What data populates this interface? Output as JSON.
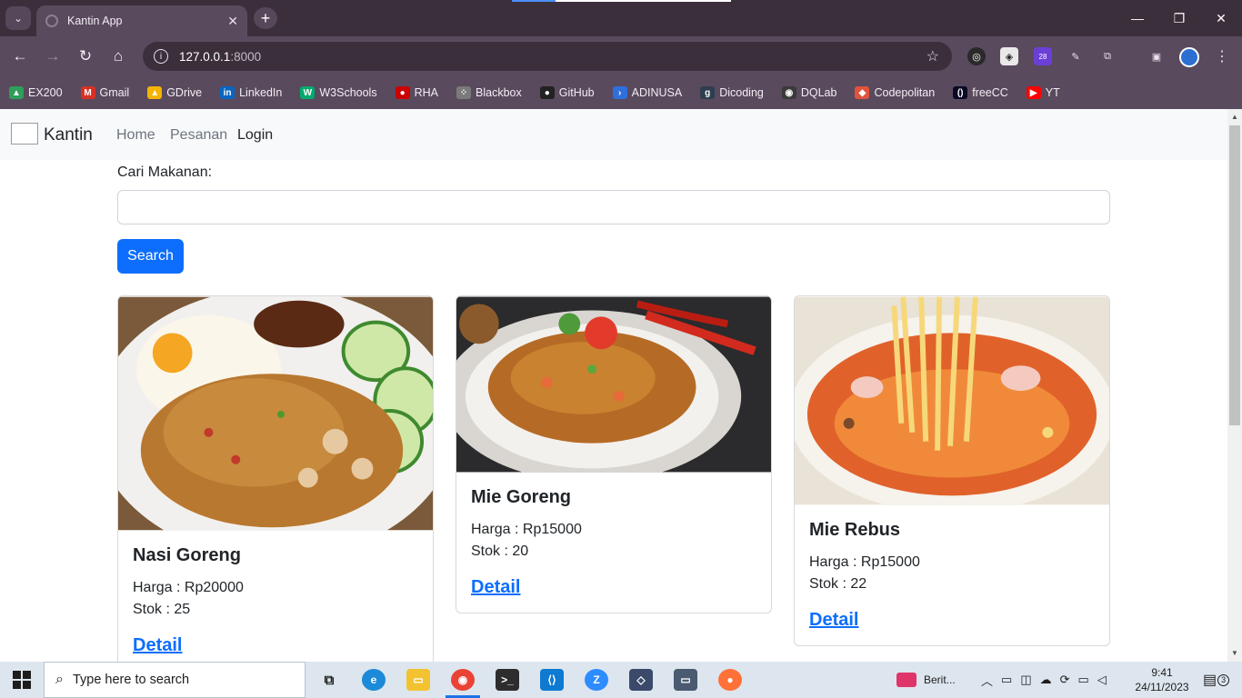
{
  "browser": {
    "tab_title": "Kantin App",
    "new_tab": "+",
    "close_tab": "✕",
    "address_host": "127.0.0.1",
    "address_port": ":8000",
    "extension_badge": "28",
    "bookmarks": [
      {
        "label": "EX200",
        "color": "#2e9e5b"
      },
      {
        "label": "Gmail",
        "color": "#d93025"
      },
      {
        "label": "GDrive",
        "color": "#f4b400"
      },
      {
        "label": "LinkedIn",
        "color": "#0a66c2"
      },
      {
        "label": "W3Schools",
        "color": "#04aa6d"
      },
      {
        "label": "RHA",
        "color": "#cc0000"
      },
      {
        "label": "Blackbox",
        "color": "#7a7a7a"
      },
      {
        "label": "GitHub",
        "color": "#222222"
      },
      {
        "label": "ADINUSA",
        "color": "#2f6fdd"
      },
      {
        "label": "Dicoding",
        "color": "#2d3e50"
      },
      {
        "label": "DQLab",
        "color": "#3a3a3a"
      },
      {
        "label": "Codepolitan",
        "color": "#e0533c"
      },
      {
        "label": "freeCC",
        "color": "#0a0a23"
      },
      {
        "label": "YT",
        "color": "#ff0000"
      }
    ]
  },
  "navbar": {
    "brand": "Kantin",
    "links": [
      "Home",
      "Pesanan",
      "Login"
    ]
  },
  "search": {
    "label": "Cari Makanan:",
    "value": "",
    "button": "Search"
  },
  "menu": [
    {
      "name": "Nasi Goreng",
      "price": "Harga : Rp20000",
      "stock": "Stok : 25",
      "link": "Detail",
      "image": "fried-rice-photo"
    },
    {
      "name": "Mie Goreng",
      "price": "Harga : Rp15000",
      "stock": "Stok : 20",
      "link": "Detail",
      "image": "fried-noodle-photo"
    },
    {
      "name": "Mie Rebus",
      "price": "Harga : Rp15000",
      "stock": "Stok : 22",
      "link": "Detail",
      "image": "noodle-soup-photo"
    }
  ],
  "taskbar": {
    "search_placeholder": "Type here to search",
    "news": "Berit...",
    "time": "9:41",
    "date": "24/11/2023",
    "notifications": "3"
  },
  "colors": {
    "primary": "#0d6efd",
    "chrome_dark": "#3c2f3c",
    "chrome": "#5a4a5e"
  }
}
